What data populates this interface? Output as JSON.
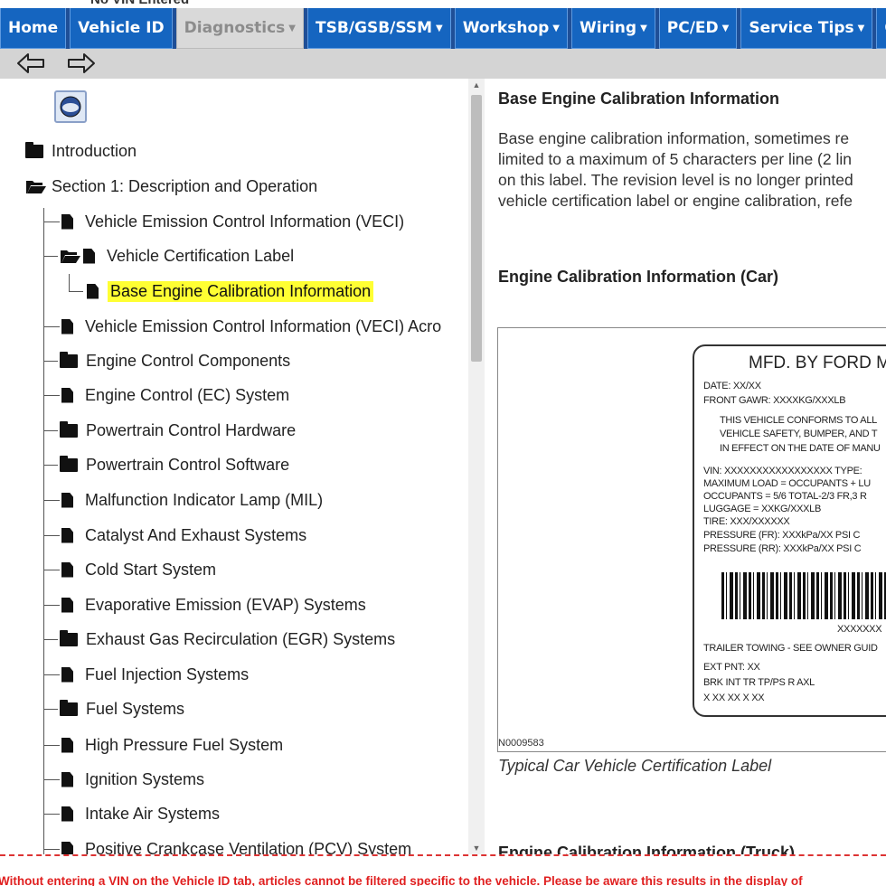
{
  "top_clip": "No VIN Entered",
  "nav": {
    "tabs": [
      {
        "label": "Home",
        "caret": false
      },
      {
        "label": "Vehicle ID",
        "caret": false
      },
      {
        "label": "Diagnostics",
        "caret": true
      },
      {
        "label": "TSB/GSB/SSM",
        "caret": true
      },
      {
        "label": "Workshop",
        "caret": true
      },
      {
        "label": "Wiring",
        "caret": true
      },
      {
        "label": "PC/ED",
        "caret": true
      },
      {
        "label": "Service Tips",
        "caret": true
      },
      {
        "label": "O",
        "caret": false
      }
    ],
    "active_tab": "Diagnostics"
  },
  "toolbar": {
    "back_icon": "arrow-left-icon",
    "forward_icon": "arrow-right-icon"
  },
  "tree": {
    "logo": "ford-logo-icon",
    "items": [
      {
        "label": "Introduction",
        "icon": "folder-icon"
      },
      {
        "label": "Section 1: Description and Operation",
        "icon": "folder-open-icon"
      },
      {
        "label": "Vehicle Emission Control Information (VECI)",
        "icon": "document-icon"
      },
      {
        "label": "Vehicle Certification Label",
        "icon": "folder-open-document-icon"
      },
      {
        "label": "Base Engine Calibration Information",
        "icon": "document-icon",
        "selected": true
      },
      {
        "label": "Vehicle Emission Control Information (VECI) Acro",
        "icon": "document-icon"
      },
      {
        "label": "Engine Control Components",
        "icon": "folder-icon"
      },
      {
        "label": "Engine Control (EC) System",
        "icon": "document-icon"
      },
      {
        "label": "Powertrain Control Hardware",
        "icon": "folder-icon"
      },
      {
        "label": "Powertrain Control Software",
        "icon": "folder-icon"
      },
      {
        "label": "Malfunction Indicator Lamp (MIL)",
        "icon": "document-icon"
      },
      {
        "label": "Catalyst And Exhaust Systems",
        "icon": "document-icon"
      },
      {
        "label": "Cold Start System",
        "icon": "document-icon"
      },
      {
        "label": "Evaporative Emission (EVAP) Systems",
        "icon": "document-icon"
      },
      {
        "label": "Exhaust Gas Recirculation (EGR) Systems",
        "icon": "folder-icon"
      },
      {
        "label": "Fuel Injection Systems",
        "icon": "document-icon"
      },
      {
        "label": "Fuel Systems",
        "icon": "folder-icon"
      },
      {
        "label": "High Pressure Fuel System",
        "icon": "document-icon"
      },
      {
        "label": "Ignition Systems",
        "icon": "document-icon"
      },
      {
        "label": "Intake Air Systems",
        "icon": "document-icon"
      },
      {
        "label": "Positive Crankcase Ventilation (PCV) System",
        "icon": "document-icon"
      }
    ]
  },
  "content": {
    "title": "Base Engine Calibration Information",
    "paragraph_lines": [
      "Base engine calibration information, sometimes re",
      "limited to a maximum of 5 characters per line (2 lin",
      "on this label. The revision level is no longer printed",
      "vehicle certification label or engine calibration, refe"
    ],
    "subheading": "Engine Calibration Information (Car)",
    "figure": {
      "label_heading": "MFD. BY FORD MO",
      "label_lines": [
        "DATE: XX/XX",
        "FRONT GAWR:  XXXXKG/XXXLB",
        "THIS VEHICLE CONFORMS TO ALL",
        "VEHICLE SAFETY, BUMPER, AND T",
        "IN EFFECT ON THE DATE OF MANU",
        "VIN:  XXXXXXXXXXXXXXXXX      TYPE:",
        "MAXIMUM LOAD = OCCUPANTS + LU",
        "OCCUPANTS = 5/6 TOTAL-2/3 FR,3 R",
        "LUGGAGE = XXKG/XXXLB",
        "TIRE:  XXX/XXXXXX",
        "PRESSURE (FR):  XXXkPa/XX      PSI C",
        "PRESSURE (RR):  XXXkPa/XX      PSI C",
        "XXXXXXX",
        "TRAILER TOWING - SEE OWNER GUID",
        "EXT PNT:    XX",
        "BRK    INT  TR   TP/PS   R   AXL",
        "X         XX         XX       X   XX"
      ],
      "figure_code": "N0009583"
    },
    "caption": "Typical Car Vehicle Certification Label",
    "next_heading": "Engine Calibration Information (Truck)"
  },
  "status": {
    "message": "Without entering a VIN on the Vehicle ID tab, articles cannot be filtered specific to the vehicle. Please be aware this results in the display of"
  }
}
